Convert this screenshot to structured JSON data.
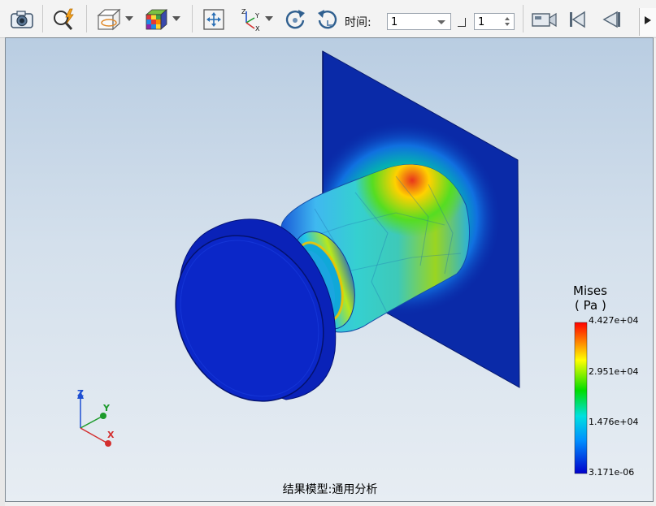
{
  "toolbar": {
    "time_label": "时间:",
    "time_value": "1",
    "frame_value": "1",
    "icons": [
      "camera-icon",
      "zoom-lightning-icon",
      "section-plane-icon",
      "color-cube-icon",
      "fit-view-icon",
      "axes-triad-icon",
      "rotate-cw-icon",
      "rotate-ccw-icon",
      "video-record-icon",
      "skip-first-icon",
      "play-reverse-icon"
    ]
  },
  "legend": {
    "title": "Mises",
    "unit": "( Pa )",
    "ticks": [
      "4.427e+04",
      "2.951e+04",
      "1.476e+04",
      "3.171e-06"
    ],
    "colors": [
      "#0000cc",
      "#00c8ff",
      "#00dd00",
      "#ffff00",
      "#ff0000"
    ]
  },
  "axes": {
    "z": "Z",
    "y": "Y",
    "x": "X"
  },
  "caption": "结果模型:通用分析",
  "colors": {
    "mesh_blue": "#0a2aa8",
    "background_top": "#b9cde2",
    "background_bottom": "#e7edf3"
  }
}
